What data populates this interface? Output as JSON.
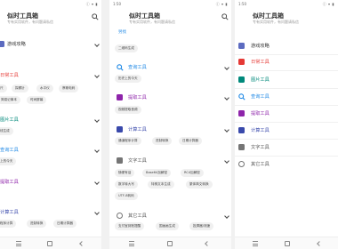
{
  "app": {
    "title": "似时工具箱",
    "subtitle": "专有实用软件，有问题请私信"
  },
  "status_bar": {
    "time": "1:50",
    "icons": "ⓘ ▾ ▮"
  },
  "panel1": {
    "categories": [
      {
        "label": "游戏攻略",
        "color": "#5c6bc0"
      },
      {
        "label": "日常工具",
        "color": "#e53935"
      },
      {
        "label": "图片工具",
        "color": "#00897b"
      },
      {
        "label": "查询工具",
        "color": "#1e88e5"
      },
      {
        "label": "提取工具",
        "color": "#8e24aa"
      },
      {
        "label": "计算工具",
        "color": "#3949ab"
      }
    ],
    "chips_daily": [
      "尺",
      "探察针",
      "水平仪",
      "摩斯电码"
    ],
    "chips_daily2": [
      "简易记事本",
      "时间屏幕"
    ],
    "chips_image": [
      "线生成"
    ],
    "chips_query": [
      "上的今天"
    ],
    "chips_calc": [
      "程序计算",
      "进制转换",
      "日期计算器"
    ]
  },
  "panel2": {
    "top_label": "另找",
    "chip_top": "二维码生成",
    "categories": [
      {
        "label": "查询工具",
        "color": "#1e88e5"
      },
      {
        "label": "提取工具",
        "color": "#8e24aa"
      },
      {
        "label": "计算工具",
        "color": "#3949ab"
      },
      {
        "label": "文字工具",
        "color": "#757575"
      },
      {
        "label": "其它工具",
        "color": "#757575"
      }
    ],
    "chips_query": [
      "历史上的今天"
    ],
    "chips_extract": [
      "视频提取音频"
    ],
    "chips_calc": [
      "通道程序计算",
      "进制转换",
      "日期计算器"
    ],
    "chips_text": [
      "随便有话",
      "Base64加解密",
      "RC4加解密"
    ],
    "chips_text2": [
      "数字转大写",
      "特殊文本生成",
      "繁体简文转换"
    ],
    "chips_text3": [
      "UTF-8转码"
    ],
    "chips_other": [
      "支付宝到账提醒",
      "国画画生成",
      "投屏器/测速"
    ]
  },
  "panel3": {
    "categories": [
      {
        "label": "游戏攻略",
        "color": "#5c6bc0"
      },
      {
        "label": "日常工具",
        "color": "#e53935"
      },
      {
        "label": "图片工具",
        "color": "#00897b"
      },
      {
        "label": "查询工具",
        "color": "#1e88e5"
      },
      {
        "label": "提取工具",
        "color": "#8e24aa"
      },
      {
        "label": "计算工具",
        "color": "#3949ab"
      },
      {
        "label": "文字工具",
        "color": "#757575"
      },
      {
        "label": "其它工具",
        "color": "#757575"
      }
    ]
  },
  "icons": {
    "search": "search-icon",
    "nav_menu": "menu-icon",
    "nav_home": "home-icon",
    "nav_back": "back-icon"
  }
}
